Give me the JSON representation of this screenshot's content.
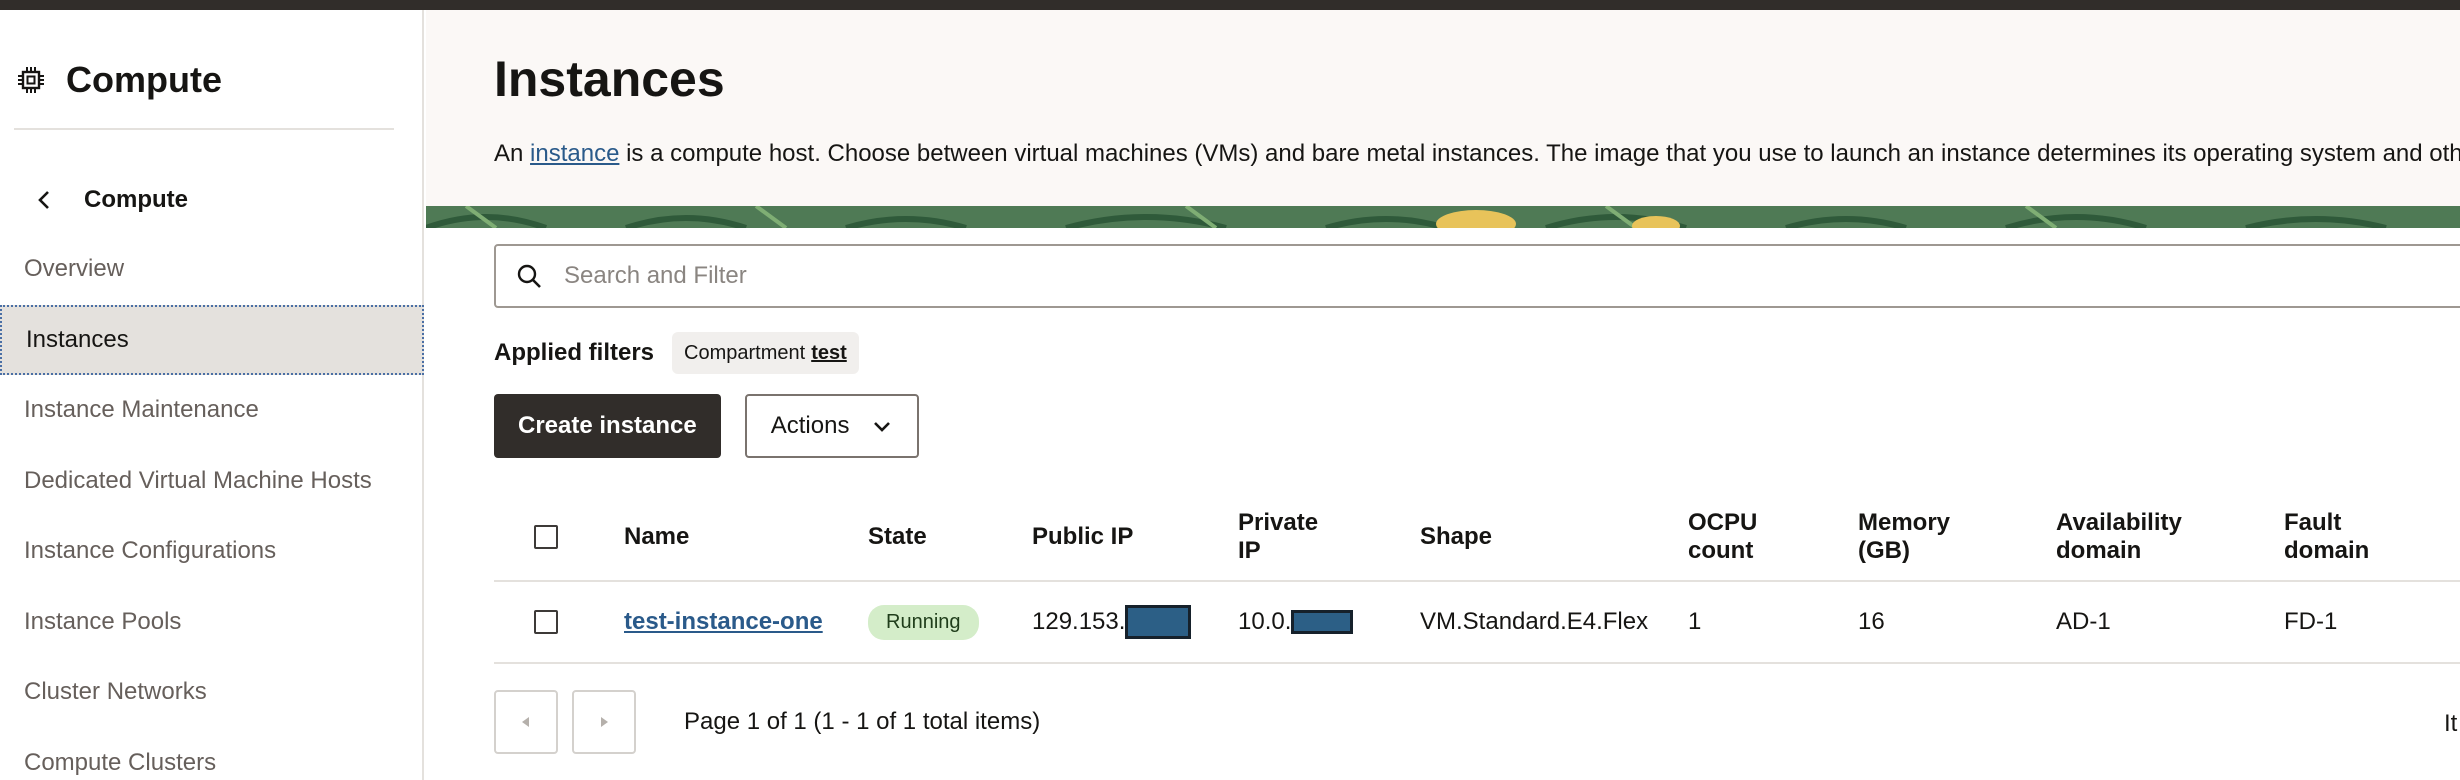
{
  "sidebar": {
    "title": "Compute",
    "back_label": "Compute",
    "items": [
      {
        "label": "Overview"
      },
      {
        "label": "Instances"
      },
      {
        "label": "Instance Maintenance"
      },
      {
        "label": "Dedicated Virtual Machine Hosts"
      },
      {
        "label": "Instance Configurations"
      },
      {
        "label": "Instance Pools"
      },
      {
        "label": "Cluster Networks"
      },
      {
        "label": "Compute Clusters"
      }
    ],
    "active_index": 1
  },
  "header": {
    "title": "Instances",
    "desc_prefix": "An ",
    "desc_link": "instance",
    "desc_suffix": " is a compute host. Choose between virtual machines (VMs) and bare metal instances. The image that you use to launch an instance determines its operating system and other"
  },
  "search": {
    "placeholder": "Search and Filter",
    "icon": "search-icon"
  },
  "filters": {
    "label": "Applied filters",
    "chip_key": "Compartment",
    "chip_value": "test"
  },
  "actions": {
    "create_label": "Create instance",
    "actions_label": "Actions"
  },
  "table": {
    "headers": {
      "name": "Name",
      "state": "State",
      "public_ip": "Public IP",
      "private_ip_1": "Private",
      "private_ip_2": "IP",
      "shape": "Shape",
      "ocpu_1": "OCPU",
      "ocpu_2": "count",
      "memory_1": "Memory",
      "memory_2": "(GB)",
      "avail_1": "Availability",
      "avail_2": "domain",
      "fault_1": "Fault",
      "fault_2": "domain"
    },
    "rows": [
      {
        "name": "test-instance-one",
        "state": "Running",
        "public_ip": "129.153.",
        "private_ip": "10.0.",
        "shape": "VM.Standard.E4.Flex",
        "ocpu": "1",
        "memory": "16",
        "availability": "AD-1",
        "fault": "FD-1"
      }
    ]
  },
  "pagination": {
    "text": "Page 1 of 1 (1 - 1 of 1 total items)",
    "right_text": "It"
  },
  "colors": {
    "primary_button": "#312d2a",
    "link": "#2a5a8a",
    "running_badge": "#d4edc9",
    "redaction": "#2c5f86"
  }
}
